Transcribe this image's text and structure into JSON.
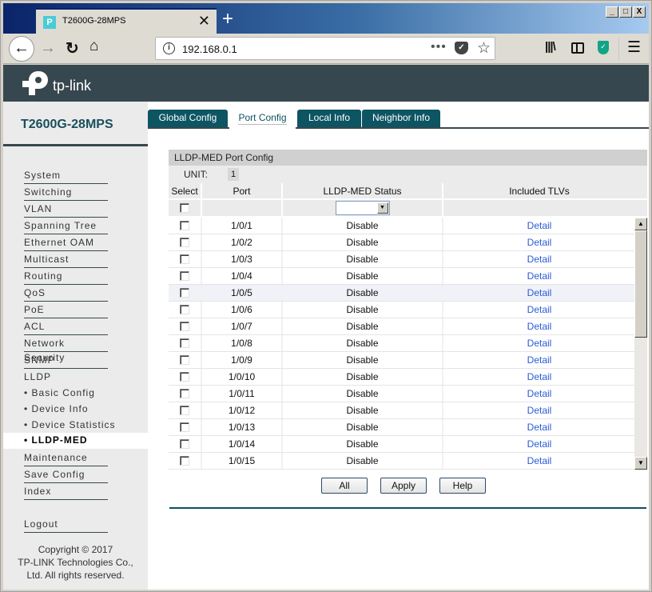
{
  "browser": {
    "tab_title": "T2600G-28MPS",
    "tab_favicon": "tp-link-favicon",
    "new_tab_label": "+",
    "url": "192.168.0.1",
    "window_controls": [
      "_",
      "□",
      "X"
    ]
  },
  "brand": {
    "logo_text": "tp-link"
  },
  "sidebar": {
    "model": "T2600G-28MPS",
    "items": [
      {
        "label": "System"
      },
      {
        "label": "Switching"
      },
      {
        "label": "VLAN"
      },
      {
        "label": "Spanning Tree"
      },
      {
        "label": "Ethernet OAM"
      },
      {
        "label": "Multicast"
      },
      {
        "label": "Routing"
      },
      {
        "label": "QoS"
      },
      {
        "label": "PoE"
      },
      {
        "label": "ACL"
      },
      {
        "label": "Network Security"
      },
      {
        "label": "SNMP"
      },
      {
        "label": "LLDP"
      }
    ],
    "sub_items": [
      {
        "label": "• Basic Config"
      },
      {
        "label": "• Device Info"
      },
      {
        "label": "• Device Statistics"
      },
      {
        "label": "• LLDP-MED",
        "active": true
      }
    ],
    "items_after": [
      {
        "label": "Maintenance"
      },
      {
        "label": "Save Config"
      },
      {
        "label": "Index"
      }
    ],
    "logout": "Logout",
    "copyright": [
      "Copyright © 2017",
      "TP-LINK Technologies Co.,",
      "Ltd. All rights reserved."
    ]
  },
  "tabs": [
    {
      "label": "Global Config"
    },
    {
      "label": "Port Config",
      "active": true
    },
    {
      "label": "Local Info"
    },
    {
      "label": "Neighbor Info"
    }
  ],
  "panel": {
    "title": "LLDP-MED Port Config",
    "unit_label": "UNIT:",
    "unit_value": "1",
    "columns": [
      "Select",
      "Port",
      "LLDP-MED Status",
      "Included TLVs"
    ],
    "filter_status_value": "",
    "rows": [
      {
        "port": "1/0/1",
        "status": "Disable",
        "tlvs": "Detail"
      },
      {
        "port": "1/0/2",
        "status": "Disable",
        "tlvs": "Detail"
      },
      {
        "port": "1/0/3",
        "status": "Disable",
        "tlvs": "Detail"
      },
      {
        "port": "1/0/4",
        "status": "Disable",
        "tlvs": "Detail"
      },
      {
        "port": "1/0/5",
        "status": "Disable",
        "tlvs": "Detail",
        "highlight": true
      },
      {
        "port": "1/0/6",
        "status": "Disable",
        "tlvs": "Detail"
      },
      {
        "port": "1/0/7",
        "status": "Disable",
        "tlvs": "Detail"
      },
      {
        "port": "1/0/8",
        "status": "Disable",
        "tlvs": "Detail"
      },
      {
        "port": "1/0/9",
        "status": "Disable",
        "tlvs": "Detail"
      },
      {
        "port": "1/0/10",
        "status": "Disable",
        "tlvs": "Detail"
      },
      {
        "port": "1/0/11",
        "status": "Disable",
        "tlvs": "Detail"
      },
      {
        "port": "1/0/12",
        "status": "Disable",
        "tlvs": "Detail"
      },
      {
        "port": "1/0/13",
        "status": "Disable",
        "tlvs": "Detail"
      },
      {
        "port": "1/0/14",
        "status": "Disable",
        "tlvs": "Detail"
      },
      {
        "port": "1/0/15",
        "status": "Disable",
        "tlvs": "Detail"
      }
    ],
    "buttons": {
      "all": "All",
      "apply": "Apply",
      "help": "Help"
    }
  },
  "colors": {
    "brand_bar": "#37474f",
    "tab_active_bg": "#ffffff",
    "tab_bg": "#0d5563",
    "link": "#2a5bd7",
    "model_text": "#1a4f5c"
  }
}
